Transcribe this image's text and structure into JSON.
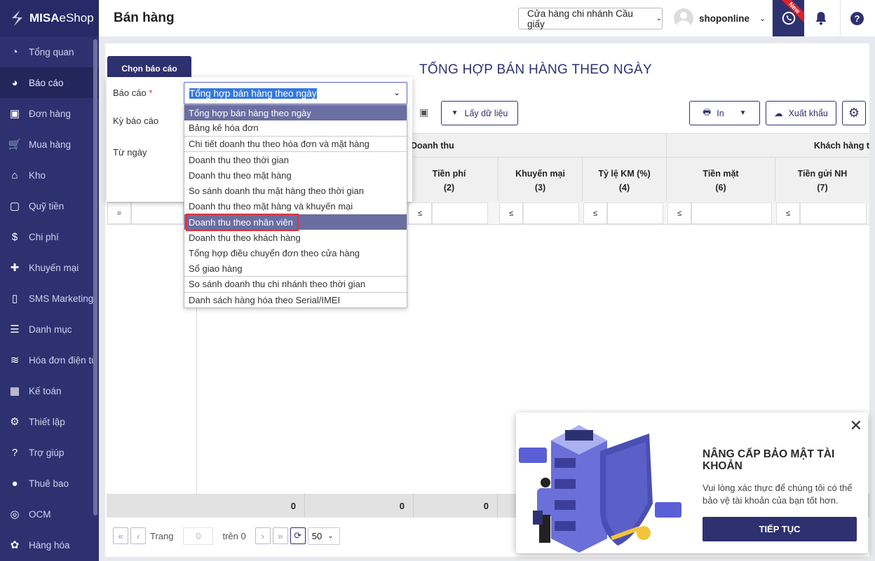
{
  "brand": {
    "name": "MISA",
    "suffix": "eShop"
  },
  "sidebar": {
    "items": [
      {
        "label": "Tổng quan",
        "icon": "dashboard-icon",
        "glyph": "◔"
      },
      {
        "label": "Báo cáo",
        "icon": "pie-chart-icon",
        "glyph": "◕"
      },
      {
        "label": "Đơn hàng",
        "icon": "order-icon",
        "glyph": "▣"
      },
      {
        "label": "Mua hàng",
        "icon": "cart-icon",
        "glyph": "🛒"
      },
      {
        "label": "Kho",
        "icon": "warehouse-icon",
        "glyph": "⌂"
      },
      {
        "label": "Quỹ tiền",
        "icon": "safe-icon",
        "glyph": "▢"
      },
      {
        "label": "Chi phí",
        "icon": "money-icon",
        "glyph": "$"
      },
      {
        "label": "Khuyến mại",
        "icon": "gift-icon",
        "glyph": "✚"
      },
      {
        "label": "SMS Marketing",
        "icon": "phone-icon",
        "glyph": "▯"
      },
      {
        "label": "Danh mục",
        "icon": "list-icon",
        "glyph": "☰"
      },
      {
        "label": "Hóa đơn điện tử",
        "icon": "invoice-icon",
        "glyph": "≋"
      },
      {
        "label": "Kế toán",
        "icon": "calculator-icon",
        "glyph": "▦"
      },
      {
        "label": "Thiết lập",
        "icon": "gear-icon",
        "glyph": "⚙"
      },
      {
        "label": "Trợ giúp",
        "icon": "help-icon",
        "glyph": "?"
      },
      {
        "label": "Thuê bao",
        "icon": "user-icon",
        "glyph": "●"
      },
      {
        "label": "OCM",
        "icon": "ocm-icon",
        "glyph": "◎"
      },
      {
        "label": "Hàng hóa",
        "icon": "goods-icon",
        "glyph": "✿"
      }
    ],
    "active": "Báo cáo"
  },
  "header": {
    "title": "Bán hàng",
    "store": "Cửa hàng chi nhánh Cầu giấy",
    "user": "shoponline",
    "new_badge": "New"
  },
  "report": {
    "tab": "Chọn báo cáo",
    "title": "TỔNG HỢP BÁN HÀNG THEO NGÀY",
    "get_data": "Lấy dữ liệu",
    "print": "In",
    "export": "Xuất khẩu"
  },
  "chooser": {
    "report_label": "Báo cáo",
    "required": "*",
    "period_label": "Kỳ báo cáo",
    "from_label": "Từ ngày",
    "selected": "Tổng hợp bán hàng theo ngày",
    "options": [
      "Tổng hợp bán hàng theo ngày",
      "Bảng kê hóa đơn",
      "Chi tiết doanh thu theo hóa đơn và mặt hàng",
      "Doanh thu theo thời gian",
      "Doanh thu theo mặt hàng",
      "So sánh doanh thu mặt hàng theo thời gian",
      "Doanh thu theo mặt hàng và khuyến mại",
      "Doanh thu theo nhân viên",
      "Doanh thu theo khách hàng",
      "Tổng hợp điều chuyển đơn theo cửa hàng",
      "Sổ giao hàng",
      "So sánh doanh thu chi nhánh theo thời gian",
      "Danh sách hàng hóa theo Serial/IMEI"
    ],
    "highlighted": "Doanh thu theo nhân viên"
  },
  "table": {
    "group1": "Doanh thu",
    "group2": "Khách hàng t",
    "columns": [
      {
        "name": "Tiền phí",
        "num": "(2)"
      },
      {
        "name": "Khuyến mại",
        "num": "(3)"
      },
      {
        "name": "Tỷ lệ KM (%)",
        "num": "(4)"
      },
      {
        "name": "Tiền mặt",
        "num": "(6)"
      },
      {
        "name": "Tiền gửi NH",
        "num": "(7)"
      }
    ],
    "filter_eq": "=",
    "filter_le": "≤",
    "totals": [
      "0",
      "0",
      "0"
    ]
  },
  "pager": {
    "page_label": "Trang",
    "page_value": "0",
    "of_label": "trên 0",
    "page_size": "50"
  },
  "popup": {
    "title": "NÂNG CẤP BẢO MẬT TÀI KHOẢN",
    "text": "Vui lòng xác thực để chúng tôi có thể bảo vệ tài khoản của bạn tốt hơn.",
    "button": "TIẾP TỤC"
  }
}
